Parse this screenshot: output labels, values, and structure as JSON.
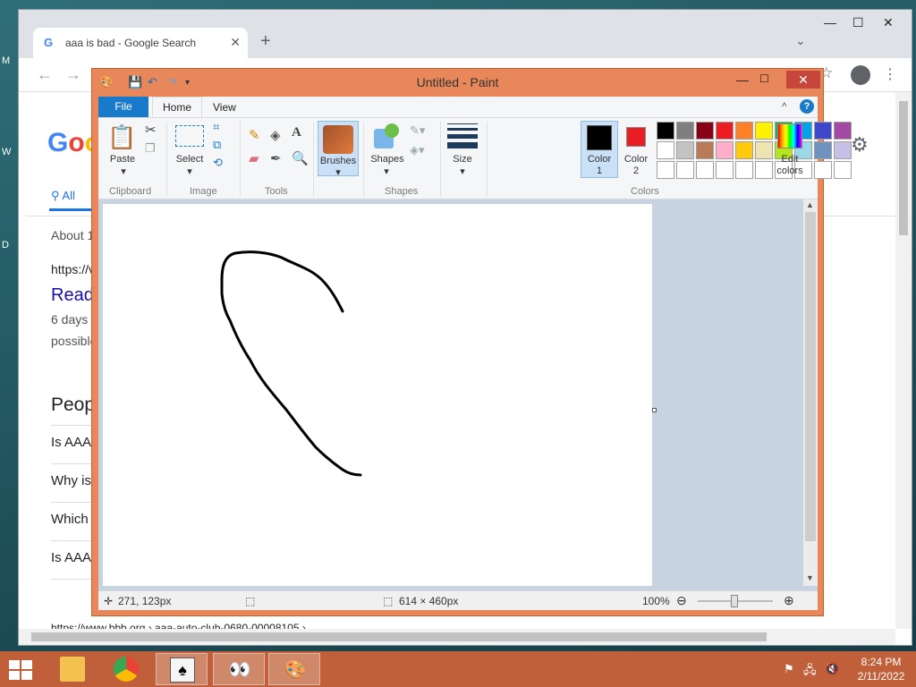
{
  "desktop": {
    "side_letters": [
      "M",
      "W",
      "D"
    ]
  },
  "chrome": {
    "tab_title": "aaa is bad - Google Search",
    "tab_close": "✕",
    "new_tab": "+",
    "tab_search": "⌄",
    "window_controls": [
      "—",
      "☐",
      "✕"
    ],
    "nav": {
      "back": "←",
      "forward": "→"
    },
    "star": "☆",
    "menu": "⋮",
    "page": {
      "logo": "Goo",
      "tab_all": "All",
      "about": "About 1",
      "result_url": "https://v",
      "result_title": "Read",
      "snippet_1": "6 days",
      "snippet_2": "possible",
      "people_also_ask": "Peop",
      "questions": [
        "Is AAA",
        "Why is",
        "Which",
        "Is AAA"
      ],
      "bottom_url": "https://www.bbb.org › aaa-auto-club-0680-00008105 › ..."
    }
  },
  "paint": {
    "title": "Untitled - Paint",
    "window_controls": {
      "minimize": "—",
      "maximize": "☐",
      "close": "✕"
    },
    "tabs": {
      "file": "File",
      "home": "Home",
      "view": "View"
    },
    "ribbon_collapse": "^",
    "help": "?",
    "groups": {
      "clipboard": {
        "label": "Clipboard",
        "paste": "Paste"
      },
      "image": {
        "label": "Image",
        "select": "Select"
      },
      "tools": {
        "label": "Tools"
      },
      "brushes": {
        "label": "Brushes"
      },
      "shapes": {
        "label": "Shapes",
        "shapes_btn": "Shapes"
      },
      "size": {
        "label": "Size"
      },
      "colors": {
        "label": "Colors",
        "color1": [
          "Color",
          "1"
        ],
        "color2": [
          "Color",
          "2"
        ],
        "edit_colors": [
          "Edit",
          "colors"
        ],
        "palette_row1": [
          "#000000",
          "#7f7f7f",
          "#880015",
          "#ed1c24",
          "#ff7f27",
          "#fff200",
          "#22b14c",
          "#00a2e8",
          "#3f48cc",
          "#a349a4"
        ],
        "palette_row2": [
          "#ffffff",
          "#c3c3c3",
          "#b97a57",
          "#ffaec9",
          "#ffc90e",
          "#efe4b0",
          "#b5e61d",
          "#99d9ea",
          "#7092be",
          "#c8bfe7"
        ],
        "palette_row3": [
          "#ffffff",
          "#ffffff",
          "#ffffff",
          "#ffffff",
          "#ffffff",
          "#ffffff",
          "#ffffff",
          "#ffffff",
          "#ffffff",
          "#ffffff"
        ],
        "color1_value": "#000000",
        "color2_value": "#e81e24"
      }
    },
    "status": {
      "cursor_pos": "271, 123px",
      "image_size": "614 × 460px",
      "zoom": "100%"
    }
  },
  "taskbar": {
    "clock_time": "8:24 PM",
    "clock_date": "2/11/2022"
  }
}
